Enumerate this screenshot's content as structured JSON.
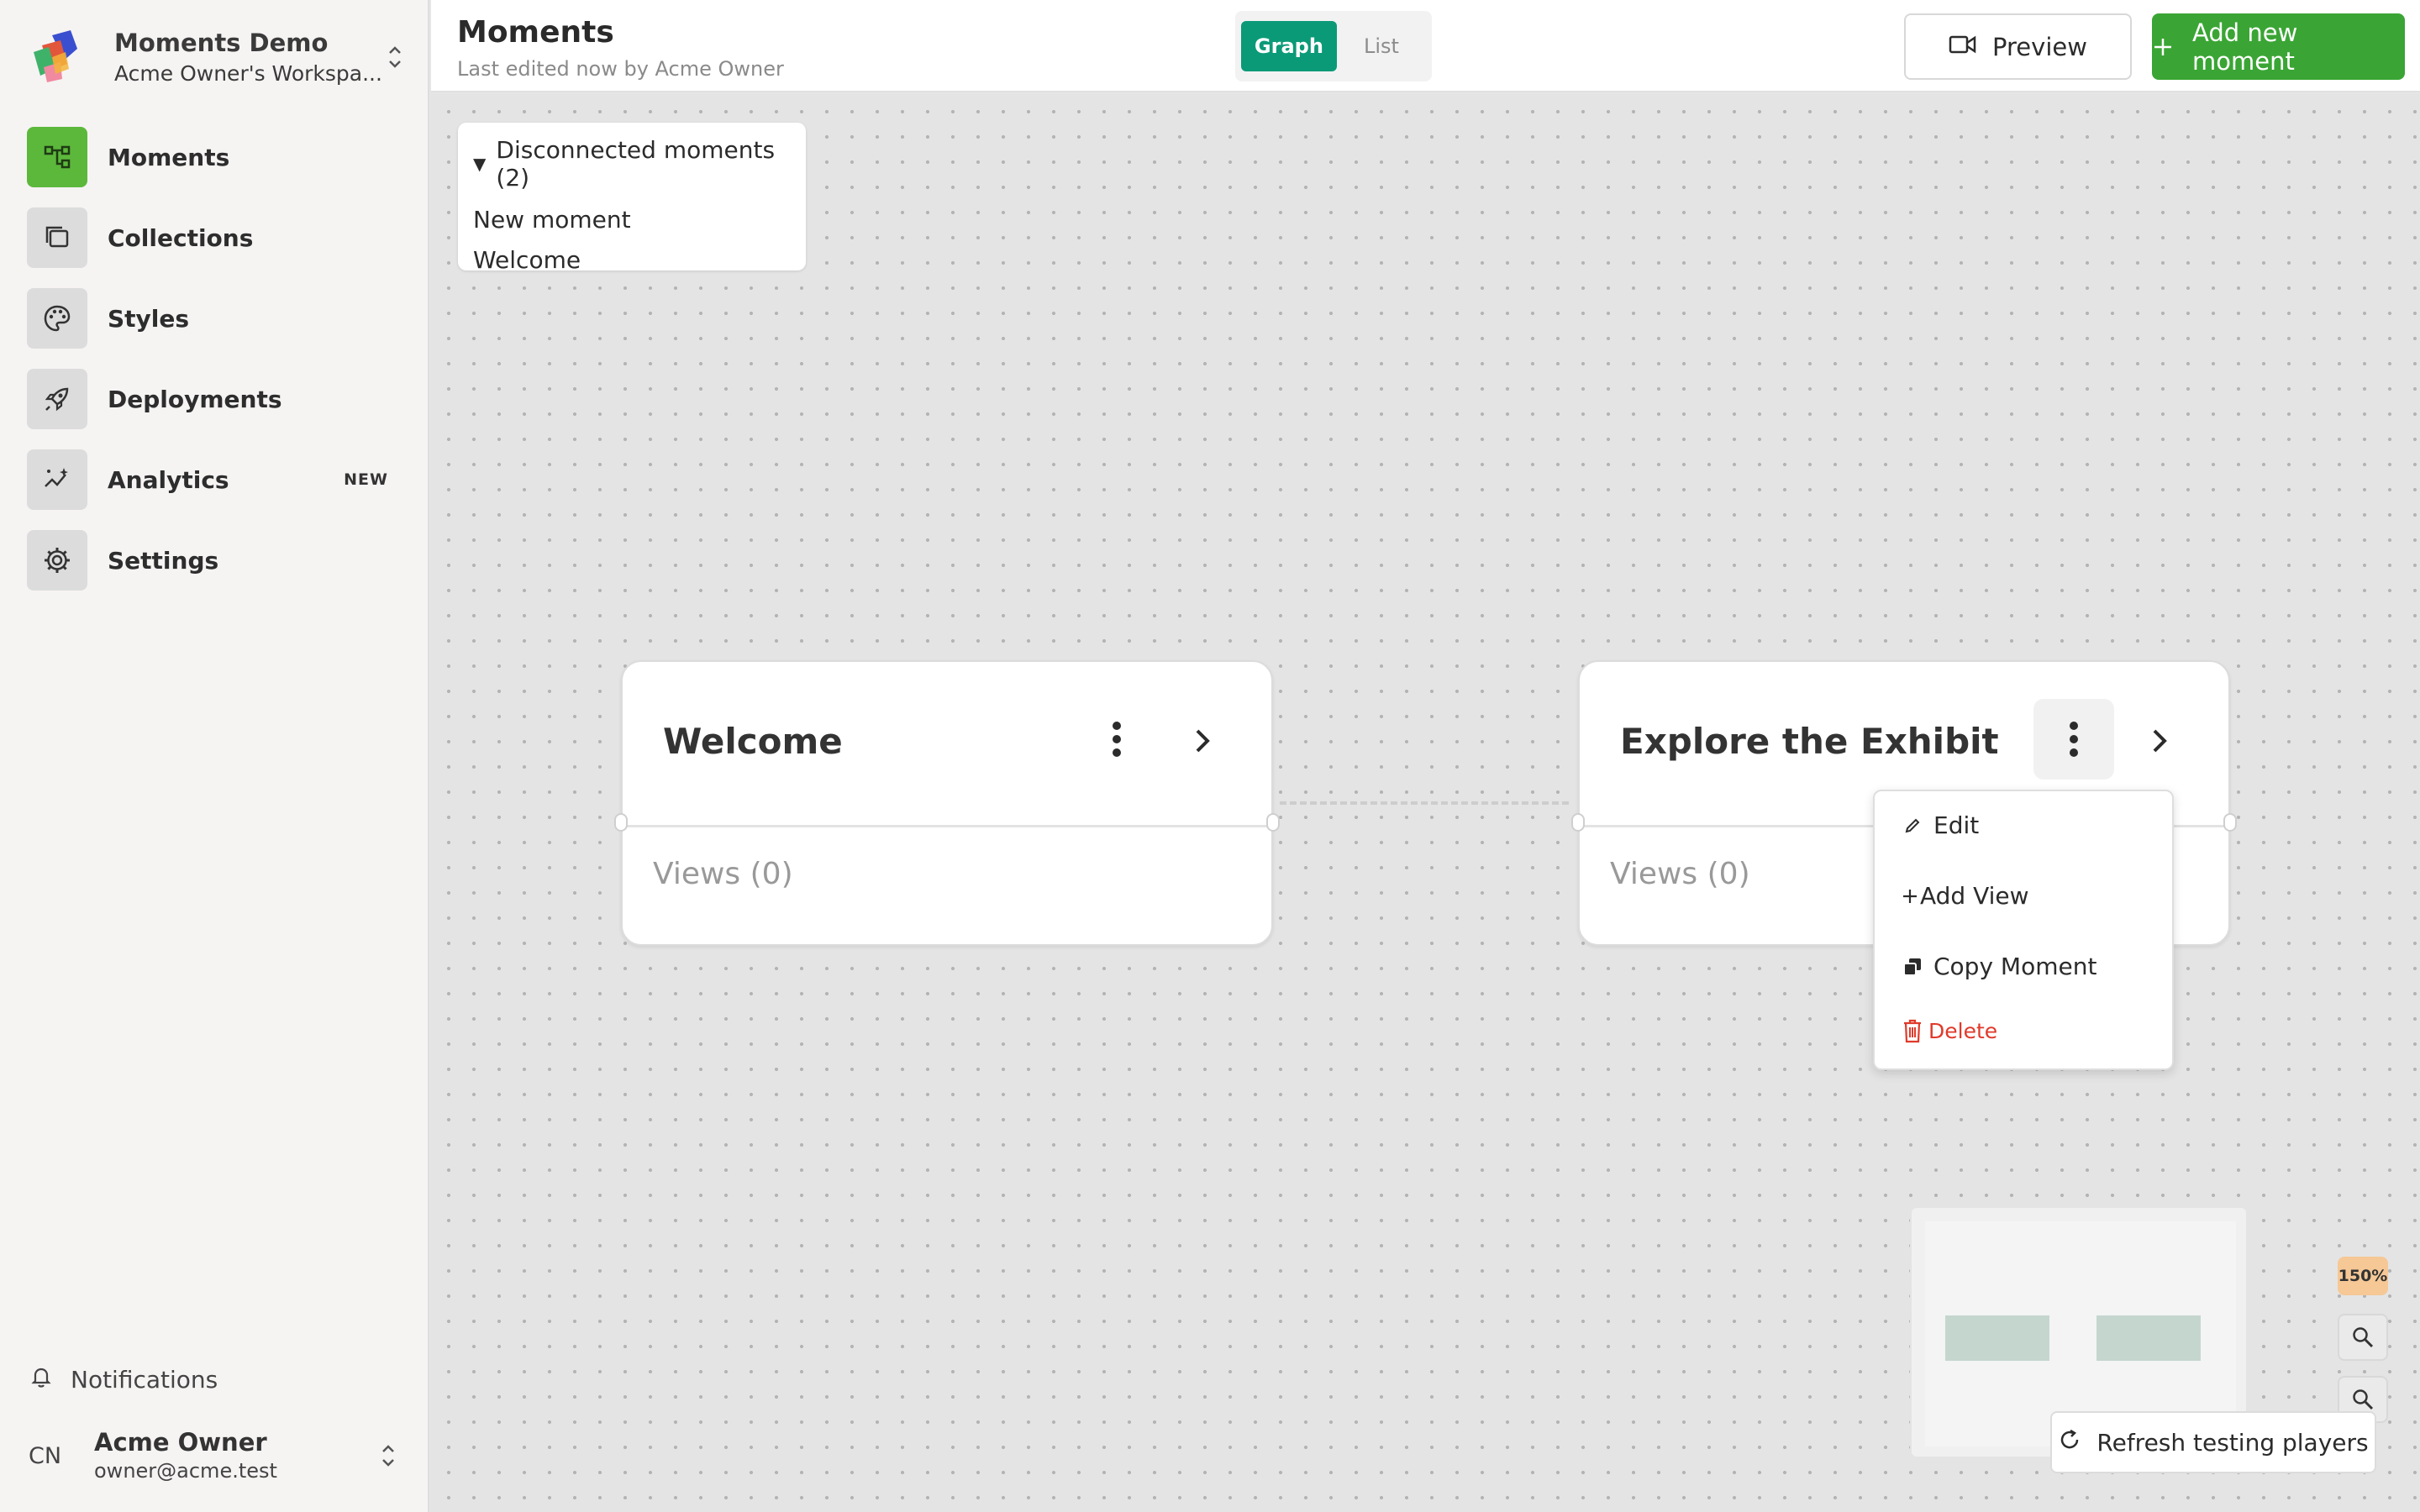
{
  "workspace": {
    "name": "Moments Demo",
    "subtitle": "Acme Owner's Workspa..."
  },
  "sidebar": {
    "items": [
      {
        "label": "Moments",
        "icon": "graph-icon",
        "active": true
      },
      {
        "label": "Collections",
        "icon": "folders-icon"
      },
      {
        "label": "Styles",
        "icon": "palette-icon"
      },
      {
        "label": "Deployments",
        "icon": "rocket-icon"
      },
      {
        "label": "Analytics",
        "icon": "sparkline-icon",
        "badge": "NEW"
      },
      {
        "label": "Settings",
        "icon": "gear-icon"
      }
    ],
    "notifications_label": "Notifications",
    "user": {
      "initials": "CN",
      "name": "Acme Owner",
      "email": "owner@acme.test"
    }
  },
  "header": {
    "title": "Moments",
    "subtitle": "Last edited now by Acme Owner",
    "view_toggle": {
      "graph": "Graph",
      "list": "List",
      "selected": "Graph"
    },
    "preview_label": "Preview",
    "add_label": "Add new moment"
  },
  "disconnected": {
    "title": "Disconnected moments (2)",
    "items": [
      "New moment",
      "Welcome"
    ]
  },
  "nodes": [
    {
      "title": "Welcome",
      "views": "Views (0)"
    },
    {
      "title": "Explore the Exhibit",
      "views": "Views (0)"
    }
  ],
  "context_menu": {
    "edit": "Edit",
    "add_view": "Add View",
    "copy": "Copy Moment",
    "delete": "Delete"
  },
  "zoom": {
    "level": "150%"
  },
  "refresh_label": "Refresh testing players",
  "colors": {
    "primary_green": "#3aa534",
    "teal": "#0b9a78",
    "active_nav": "#5cb83b",
    "danger": "#e03a2a",
    "zoom_badge": "#f5c896"
  }
}
